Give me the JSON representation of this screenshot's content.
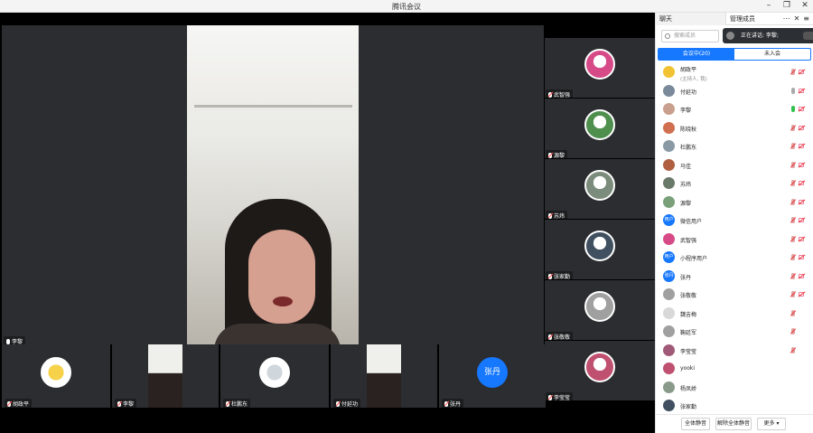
{
  "window": {
    "title": "腾讯会议"
  },
  "stage": {
    "main_speaker": "李黎"
  },
  "right_tiles": [
    {
      "name": "武智强",
      "color": "#d64a88"
    },
    {
      "name": "源黎",
      "color": "#4e8f4e"
    },
    {
      "name": "苏炜",
      "color": "#7c8c7c"
    },
    {
      "name": "张家勤",
      "color": "#405060"
    },
    {
      "name": "张敬敬",
      "color": "#a0a0a0"
    },
    {
      "name": "李莹莹",
      "color": "#c05070"
    }
  ],
  "bottom_tiles": [
    {
      "name": "胡政平",
      "kind": "avatar"
    },
    {
      "name": "李黎",
      "kind": "video"
    },
    {
      "name": "杜鹏东",
      "kind": "avatar"
    },
    {
      "name": "付延功",
      "kind": "video"
    },
    {
      "name": "张丹",
      "kind": "initial",
      "initial": "张丹"
    }
  ],
  "panel": {
    "tab_chat": "聊天",
    "tab_manage": "管理成员",
    "search_placeholder": "搜索成员",
    "speaking_label": "正在讲话: 李黎;",
    "seg_in_meeting": "会议中(20)",
    "seg_not_joined": "未入会",
    "participants": [
      {
        "name": "胡政平",
        "sub": "(主持人, 我)",
        "mic": "off",
        "cam": "off",
        "av": "#f1c232"
      },
      {
        "name": "付延功",
        "sub": "",
        "mic": "idle",
        "cam": "off",
        "av": "#7b8a9a"
      },
      {
        "name": "李黎",
        "sub": "",
        "mic": "on",
        "cam": "off",
        "av": "#c9a08f"
      },
      {
        "name": "陈晓秋",
        "sub": "",
        "mic": "off",
        "cam": "off",
        "av": "#d07050"
      },
      {
        "name": "杜鹏东",
        "sub": "",
        "mic": "off",
        "cam": "off",
        "av": "#8a9aa5"
      },
      {
        "name": "马佳",
        "sub": "",
        "mic": "off",
        "cam": "off",
        "av": "#b06040"
      },
      {
        "name": "苏炜",
        "sub": "",
        "mic": "off",
        "cam": "off",
        "av": "#6a7a6a"
      },
      {
        "name": "源黎",
        "sub": "",
        "mic": "off",
        "cam": "off",
        "av": "#7aa07a"
      },
      {
        "name": "微信用户",
        "sub": "",
        "mic": "off",
        "cam": "off",
        "av": "#1677ff",
        "initial": "用户"
      },
      {
        "name": "武智强",
        "sub": "",
        "mic": "off",
        "cam": "off",
        "av": "#d64a88"
      },
      {
        "name": "小程序用户",
        "sub": "",
        "mic": "off",
        "cam": "off",
        "av": "#1677ff",
        "initial": "用户"
      },
      {
        "name": "张丹",
        "sub": "",
        "mic": "off",
        "cam": "off",
        "av": "#1677ff",
        "initial": "张丹"
      },
      {
        "name": "张敬敬",
        "sub": "",
        "mic": "off",
        "cam": "off",
        "av": "#a0a0a0"
      },
      {
        "name": "魏吉梅",
        "sub": "",
        "mic": "off",
        "cam": "none",
        "av": "#d8d8d8"
      },
      {
        "name": "鞠廷军",
        "sub": "",
        "mic": "off",
        "cam": "none",
        "av": "#a0a0a0"
      },
      {
        "name": "李莹莹",
        "sub": "",
        "mic": "off",
        "cam": "none",
        "av": "#a05a78"
      },
      {
        "name": "yooki",
        "sub": "",
        "mic": "none",
        "cam": "none",
        "av": "#c05070"
      },
      {
        "name": "杨凤娇",
        "sub": "",
        "mic": "none",
        "cam": "none",
        "av": "#8a9a8a"
      },
      {
        "name": "张家勤",
        "sub": "",
        "mic": "none",
        "cam": "none",
        "av": "#405060"
      }
    ],
    "btn_mute_all": "全体静音",
    "btn_unmute_all": "解除全体静音",
    "btn_more": "更多 ▾"
  }
}
